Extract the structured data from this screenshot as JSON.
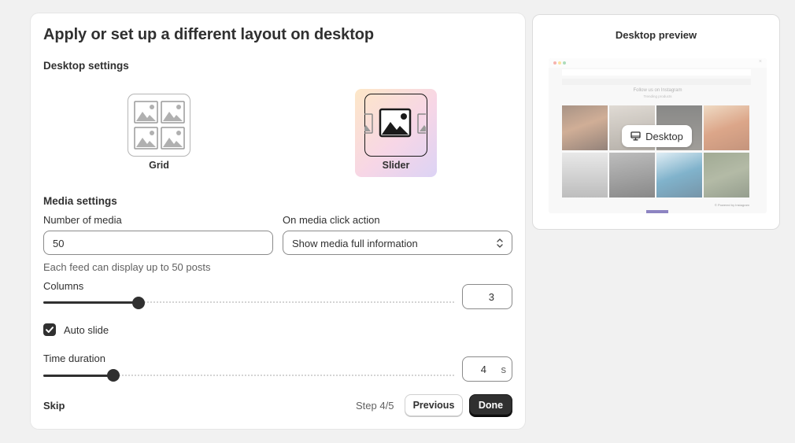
{
  "main": {
    "title": "Apply or set up a different layout on desktop",
    "desktop_settings_title": "Desktop settings",
    "layouts": [
      {
        "label": "Grid",
        "icon": "grid-layout-icon",
        "selected": false
      },
      {
        "label": "Slider",
        "icon": "slider-layout-icon",
        "selected": true
      }
    ],
    "media_settings_title": "Media settings",
    "number_of_media": {
      "label": "Number of media",
      "value": "50",
      "help": "Each feed can display up to 50 posts"
    },
    "click_action": {
      "label": "On media click action",
      "selected": "Show media full information"
    },
    "columns": {
      "label": "Columns",
      "value": "3",
      "level": 0.23
    },
    "auto_slide": {
      "label": "Auto slide",
      "checked": true
    },
    "time_duration": {
      "label": "Time duration",
      "value": "4",
      "unit": "s",
      "level": 0.17
    },
    "footer": {
      "skip": "Skip",
      "step": "Step 4/5",
      "previous": "Previous",
      "done": "Done"
    }
  },
  "preview": {
    "title": "Desktop preview",
    "mock_heading": "Follow us on Instagram",
    "mock_subheading": "Trending products",
    "mock_footer": "© Powered by Instagram",
    "badge_label": "Desktop",
    "badge_icon": "monitor-icon"
  },
  "colors": {
    "accent": "#303030",
    "slider_gradient": [
      "#fde7c7",
      "#f7d6e6",
      "#dcd3f5"
    ],
    "pager": "#8d84c2"
  }
}
